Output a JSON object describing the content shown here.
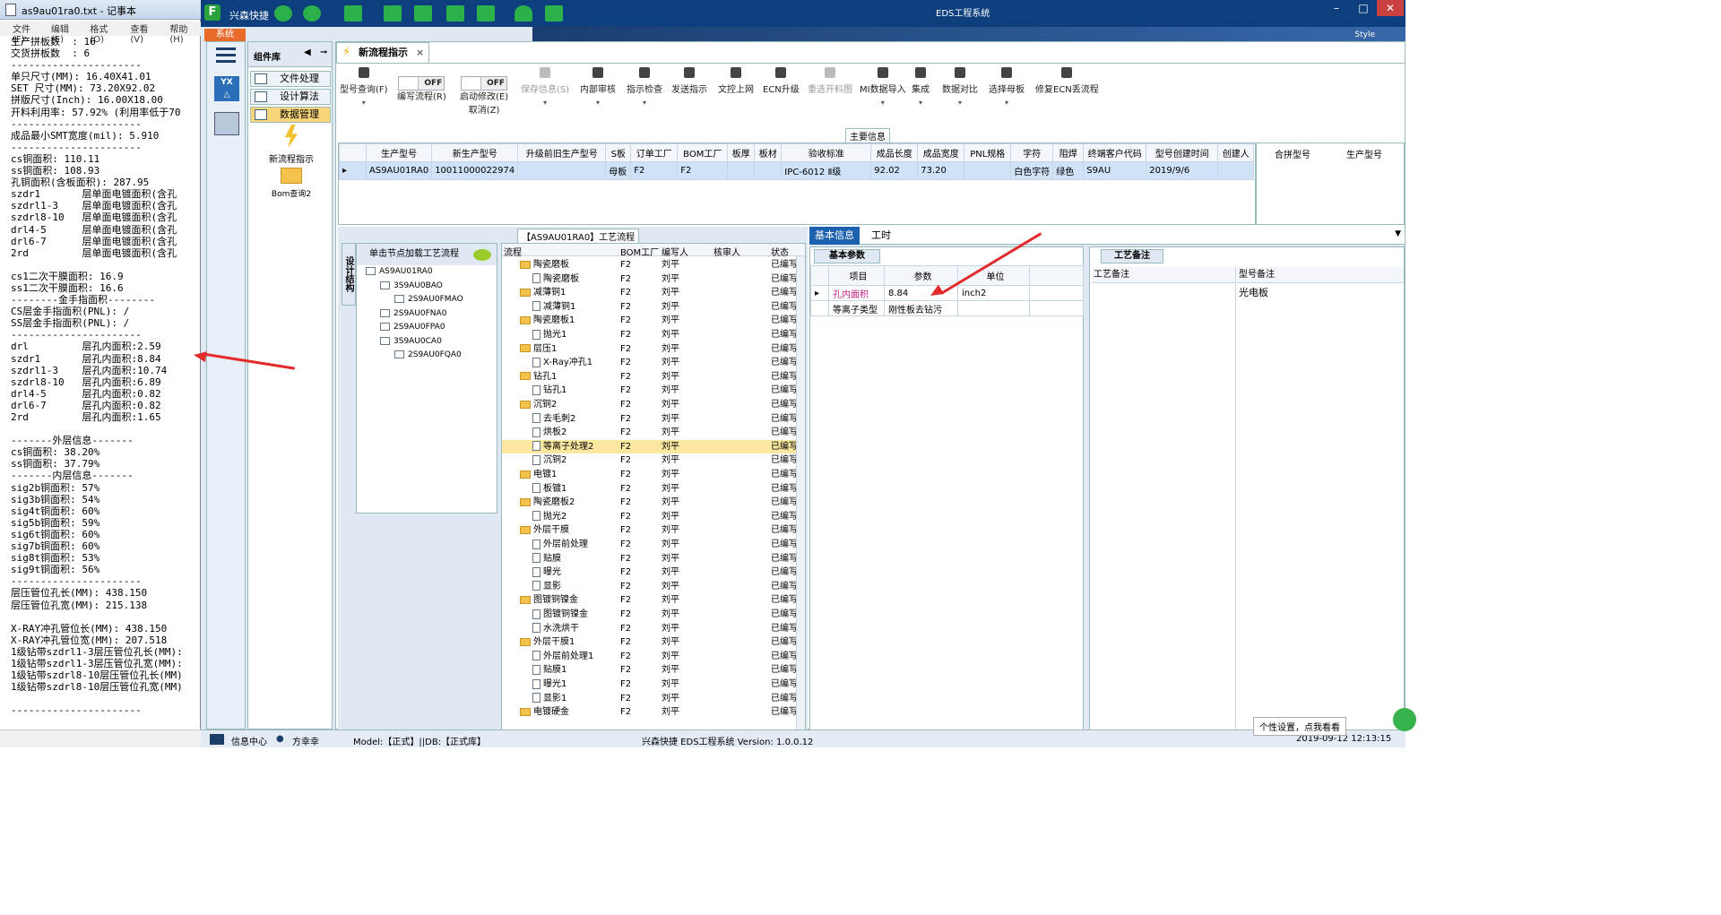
{
  "notepad": {
    "title": "as9au01ra0.txt - 记事本",
    "menu": [
      "文件(F)",
      "编辑(E)",
      "格式(O)",
      "查看(V)",
      "帮助(H)"
    ],
    "lines": [
      "生产拼板数  : 16",
      "交货拼板数  : 6",
      "----------------------",
      "单只尺寸(MM): 16.40X41.01",
      "SET 尺寸(MM): 73.20X92.02",
      "拼版尺寸(Inch): 16.00X18.00",
      "开料利用率: 57.92% (利用率低于70",
      "----------------------",
      "成品最小SMT宽度(mil): 5.910",
      "----------------------",
      "cs铜面积: 110.11",
      "ss铜面积: 108.93",
      "孔铜面积(含板面积): 287.95",
      "szdr1       层单面电镀面积(含孔",
      "szdrl1-3    层单面电镀面积(含孔",
      "szdrl8-10   层单面电镀面积(含孔",
      "drl4-5      层单面电镀面积(含孔",
      "drl6-7      层单面电镀面积(含孔",
      "2rd         层单面电镀面积(含孔",
      "",
      "cs1二次干膜面积: 16.9",
      "ss1二次干膜面积: 16.6",
      "--------金手指面积--------",
      "CS层金手指面积(PNL): /",
      "SS层金手指面积(PNL): /",
      "----------------------",
      "drl         层孔内面积:2.59",
      "szdr1       层孔内面积:8.84",
      "szdrl1-3    层孔内面积:10.74",
      "szdrl8-10   层孔内面积:6.89",
      "drl4-5      层孔内面积:0.82",
      "drl6-7      层孔内面积:0.82",
      "2rd         层孔内面积:1.65",
      "",
      "-------外层信息-------",
      "cs铜面积: 38.20%",
      "ss铜面积: 37.79%",
      "-------内层信息-------",
      "sig2b铜面积: 57%",
      "sig3b铜面积: 54%",
      "sig4t铜面积: 60%",
      "sig5b铜面积: 59%",
      "sig6t铜面积: 60%",
      "sig7b铜面积: 60%",
      "sig8t铜面积: 53%",
      "sig9t铜面积: 56%",
      "----------------------",
      "层压管位孔长(MM): 438.150",
      "层压管位孔宽(MM): 215.138",
      "",
      "X-RAY冲孔管位长(MM): 438.150",
      "X-RAY冲孔管位宽(MM): 207.518",
      "1级钻带szdrl1-3层压管位孔长(MM):",
      "1级钻带szdrl1-3层压管位孔宽(MM):",
      "1级钻带szdrl8-10层压管位孔长(MM)",
      "1级钻带szdrl8-10层压管位孔宽(MM)",
      "",
      "----------------------"
    ]
  },
  "app": {
    "name": "兴森快捷",
    "window_title": "EDS工程系统",
    "system_tab": "系统",
    "style_label": "Style",
    "component_lib": "组件库",
    "nav_items": [
      "文件处理",
      "设计算法",
      "数据管理"
    ],
    "components": [
      "新流程指示",
      "Bom查询2"
    ],
    "doc_tab": "新流程指示",
    "toolbar": [
      {
        "label": "型号查询(F)",
        "icon": "search-icon",
        "dd": true,
        "disabled": false
      },
      {
        "label": "编写流程(R)",
        "icon": "toggle",
        "toggle": "OFF",
        "disabled": false
      },
      {
        "label": "启动修改(E)\n取消(Z)",
        "icon": "toggle",
        "toggle": "OFF",
        "disabled": false
      },
      {
        "label": "保存信息(S)",
        "icon": "check-icon",
        "dd": true,
        "disabled": true
      },
      {
        "label": "内部审核",
        "icon": "print-icon",
        "dd": true,
        "disabled": false
      },
      {
        "label": "指示检查",
        "icon": "checklist-icon",
        "dd": true,
        "disabled": false
      },
      {
        "label": "发送指示",
        "icon": "upload-icon",
        "dd": false,
        "disabled": false
      },
      {
        "label": "文控上网",
        "icon": "cloud-icon",
        "dd": false,
        "disabled": false
      },
      {
        "label": "ECN升级",
        "icon": "binoculars-icon",
        "dd": false,
        "disabled": false
      },
      {
        "label": "重选开料图",
        "icon": "image-icon",
        "dd": false,
        "disabled": true
      },
      {
        "label": "MI数据导入",
        "icon": "import-icon",
        "dd": true,
        "disabled": false
      },
      {
        "label": "集成",
        "icon": "download-icon",
        "dd": true,
        "disabled": false
      },
      {
        "label": "数据对比",
        "icon": "compare-icon",
        "dd": true,
        "disabled": false
      },
      {
        "label": "选择母板",
        "icon": "shuffle-icon",
        "dd": true,
        "disabled": false
      },
      {
        "label": "修复ECN丢流程",
        "icon": "wrench-icon",
        "dd": false,
        "disabled": false
      }
    ],
    "main_info_header": "主要信息",
    "grid_columns": [
      "生产型号",
      "新生产型号",
      "升级前旧生产型号",
      "S板",
      "订单工厂",
      "BOM工厂",
      "板厚",
      "板材",
      "验收标准",
      "成品长度",
      "成品宽度",
      "PNL规格",
      "字符",
      "阻焊",
      "终端客户代码",
      "型号创建时间",
      "创建人"
    ],
    "grid_row": [
      "AS9AU01RA0",
      "10011000022974",
      "",
      "母板",
      "F2",
      "F2",
      "",
      "",
      "IPC-6012 Ⅱ级",
      "92.02",
      "73.20",
      "",
      "白色字符",
      "绿色",
      "S9AU",
      "2019/9/6",
      ""
    ],
    "side_grid_columns": [
      "合拼型号",
      "生产型号"
    ],
    "process_header": "【AS9AU01RA0】工艺流程",
    "side_tab": "设计结构",
    "tree_hint": "单击节点加载工艺流程",
    "tree": [
      {
        "label": "AS9AU01RA0",
        "level": 0
      },
      {
        "label": "3S9AU0BAO",
        "level": 1
      },
      {
        "label": "2S9AU0FMAO",
        "level": 2
      },
      {
        "label": "2S9AU0FNA0",
        "level": 1
      },
      {
        "label": "2S9AU0FPA0",
        "level": 1
      },
      {
        "label": "3S9AU0CA0",
        "level": 1
      },
      {
        "label": "2S9AU0FQA0",
        "level": 2
      }
    ],
    "flow_columns": [
      "流程",
      "BOM工厂",
      "编写人",
      "核审人",
      "状态"
    ],
    "flow_rows": [
      {
        "name": "陶瓷磨板",
        "type": "folder",
        "bom": "F2",
        "writer": "刘平",
        "status": "已编写"
      },
      {
        "name": "陶瓷磨板",
        "type": "doc",
        "bom": "F2",
        "writer": "刘平",
        "status": "已编写"
      },
      {
        "name": "减薄铜1",
        "type": "folder",
        "bom": "F2",
        "writer": "刘平",
        "status": "已编写"
      },
      {
        "name": "减薄铜1",
        "type": "doc",
        "bom": "F2",
        "writer": "刘平",
        "status": "已编写"
      },
      {
        "name": "陶瓷磨板1",
        "type": "folder",
        "bom": "F2",
        "writer": "刘平",
        "status": "已编写"
      },
      {
        "name": "抛光1",
        "type": "doc",
        "bom": "F2",
        "writer": "刘平",
        "status": "已编写"
      },
      {
        "name": "层压1",
        "type": "folder",
        "bom": "F2",
        "writer": "刘平",
        "status": "已编写"
      },
      {
        "name": "X-Ray冲孔1",
        "type": "doc",
        "bom": "F2",
        "writer": "刘平",
        "status": "已编写"
      },
      {
        "name": "钻孔1",
        "type": "folder",
        "bom": "F2",
        "writer": "刘平",
        "status": "已编写"
      },
      {
        "name": "钻孔1",
        "type": "doc",
        "bom": "F2",
        "writer": "刘平",
        "status": "已编写"
      },
      {
        "name": "沉铜2",
        "type": "folder",
        "bom": "F2",
        "writer": "刘平",
        "status": "已编写"
      },
      {
        "name": "去毛刺2",
        "type": "doc",
        "bom": "F2",
        "writer": "刘平",
        "status": "已编写"
      },
      {
        "name": "烘板2",
        "type": "doc",
        "bom": "F2",
        "writer": "刘平",
        "status": "已编写"
      },
      {
        "name": "等离子处理2",
        "type": "doc",
        "bom": "F2",
        "writer": "刘平",
        "status": "已编写",
        "selected": true
      },
      {
        "name": "沉铜2",
        "type": "doc",
        "bom": "F2",
        "writer": "刘平",
        "status": "已编写"
      },
      {
        "name": "电镀1",
        "type": "folder",
        "bom": "F2",
        "writer": "刘平",
        "status": "已编写"
      },
      {
        "name": "板镀1",
        "type": "doc",
        "bom": "F2",
        "writer": "刘平",
        "status": "已编写"
      },
      {
        "name": "陶瓷磨板2",
        "type": "folder",
        "bom": "F2",
        "writer": "刘平",
        "status": "已编写"
      },
      {
        "name": "抛光2",
        "type": "doc",
        "bom": "F2",
        "writer": "刘平",
        "status": "已编写"
      },
      {
        "name": "外层干膜",
        "type": "folder",
        "bom": "F2",
        "writer": "刘平",
        "status": "已编写"
      },
      {
        "name": "外层前处理",
        "type": "doc",
        "bom": "F2",
        "writer": "刘平",
        "status": "已编写"
      },
      {
        "name": "贴膜",
        "type": "doc",
        "bom": "F2",
        "writer": "刘平",
        "status": "已编写"
      },
      {
        "name": "曝光",
        "type": "doc",
        "bom": "F2",
        "writer": "刘平",
        "status": "已编写"
      },
      {
        "name": "显影",
        "type": "doc",
        "bom": "F2",
        "writer": "刘平",
        "status": "已编写"
      },
      {
        "name": "图镀铜镍金",
        "type": "folder",
        "bom": "F2",
        "writer": "刘平",
        "status": "已编写"
      },
      {
        "name": "图镀铜镍金",
        "type": "doc",
        "bom": "F2",
        "writer": "刘平",
        "status": "已编写"
      },
      {
        "name": "水洗烘干",
        "type": "doc",
        "bom": "F2",
        "writer": "刘平",
        "status": "已编写"
      },
      {
        "name": "外层干膜1",
        "type": "folder",
        "bom": "F2",
        "writer": "刘平",
        "status": "已编写"
      },
      {
        "name": "外层前处理1",
        "type": "doc",
        "bom": "F2",
        "writer": "刘平",
        "status": "已编写"
      },
      {
        "name": "贴膜1",
        "type": "doc",
        "bom": "F2",
        "writer": "刘平",
        "status": "已编写"
      },
      {
        "name": "曝光1",
        "type": "doc",
        "bom": "F2",
        "writer": "刘平",
        "status": "已编写"
      },
      {
        "name": "显影1",
        "type": "doc",
        "bom": "F2",
        "writer": "刘平",
        "status": "已编写"
      },
      {
        "name": "电镀硬金",
        "type": "folder",
        "bom": "F2",
        "writer": "刘平",
        "status": "已编写"
      }
    ],
    "right_tabs": [
      "基本信息",
      "工时"
    ],
    "basic_tab": "基本参数",
    "basic_columns": [
      "项目",
      "参数",
      "单位"
    ],
    "basic_rows": [
      {
        "item": "孔内面积",
        "value": "8.84",
        "unit": "inch2"
      },
      {
        "item": "等离子类型",
        "value": "刚性板去钻污",
        "unit": ""
      }
    ],
    "notes_tab": "工艺备注",
    "notes_columns": [
      "工艺备注",
      "型号备注"
    ],
    "model_note": "光电板",
    "status": {
      "info_center": "信息中心",
      "user": "方幸幸",
      "model": "Model:【正式】||DB:【正式库】",
      "footer": "兴森快捷 EDS工程系统 Version: 1.0.0.12",
      "time": "2019-09-12 12:13:15",
      "tooltip": "个性设置，点我看看"
    },
    "colors": {
      "accent": "#1c60b0",
      "title_bar": "#0d3f7e",
      "arrow": "#e32b2b",
      "highlight": "#f8d679"
    }
  }
}
